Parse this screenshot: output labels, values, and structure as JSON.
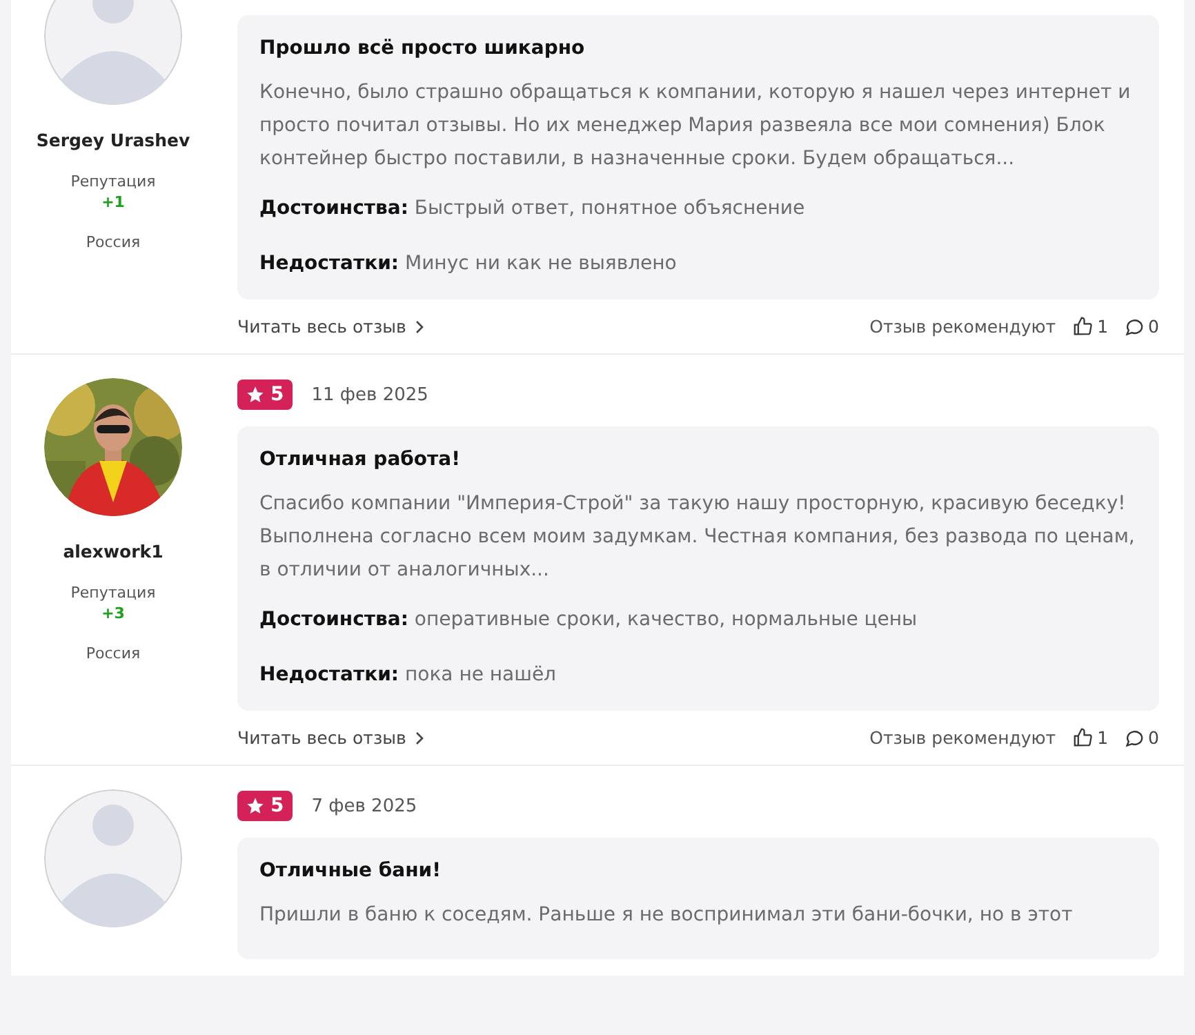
{
  "reviews": [
    {
      "author": "Sergey Urashev",
      "avatar": {
        "kind": "placeholder"
      },
      "reputation_label": "Репутация",
      "reputation": "+1",
      "country": "Россия",
      "title": "Прошло всё просто шикарно",
      "text": "Конечно, было страшно обращаться к компании, которую я нашел через интернет и просто почитал отзывы. Но их менеджер Мария развеяла все мои сомнения) Блок контейнер быстро поставили, в назначенные сроки. Будем обращаться...",
      "pros_label": "Достоинства:",
      "pros": "Быстрый ответ, понятное объяснение",
      "cons_label": "Недостатки:",
      "cons": "Минус ни как не выявлено",
      "read_more": "Читать весь отзыв",
      "recommend_label": "Отзыв рекомендуют",
      "likes": "1",
      "comments": "0"
    },
    {
      "author": "alexwork1",
      "reputation_label": "Репутация",
      "reputation": "+3",
      "country": "Россия",
      "rating": "5",
      "date": "11 фев 2025",
      "title": "Отличная работа!",
      "text": "Спасибо компании \"Империя-Строй\" за такую нашу просторную, красивую беседку! Выполнена согласно всем моим задумкам. Честная компания, без развода по ценам, в отличии от аналогичных...",
      "pros_label": "Достоинства:",
      "pros": "оперативные сроки, качество, нормальные цены",
      "cons_label": "Недостатки:",
      "cons": "пока не нашёл",
      "read_more": "Читать весь отзыв",
      "recommend_label": "Отзыв рекомендуют",
      "likes": "1",
      "comments": "0"
    },
    {
      "avatar": {
        "kind": "placeholder"
      },
      "rating": "5",
      "date": "7 фев 2025",
      "title": "Отличные бани!",
      "text": "Пришли в баню к соседям. Раньше я не воспринимал эти бани-бочки, но в этот"
    }
  ]
}
